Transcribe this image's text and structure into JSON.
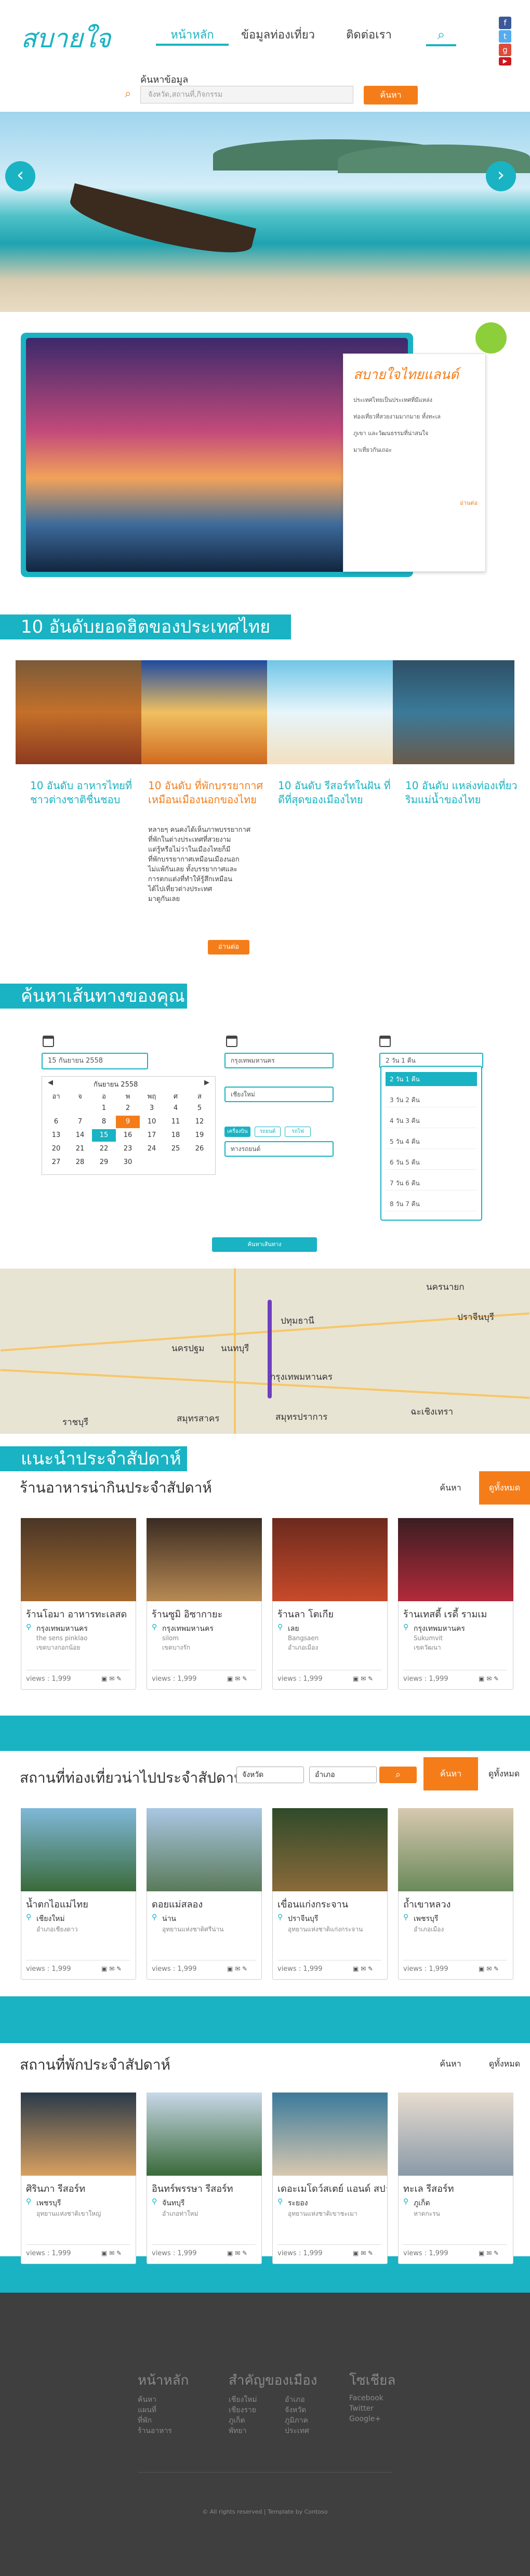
{
  "header": {
    "logo": "สบายใจ",
    "nav": [
      "หน้าหลัก",
      "ข้อมูลท่องเที่ยว",
      "ติดต่อเรา"
    ],
    "social_icons": [
      "facebook-icon",
      "twitter-icon",
      "googleplus-icon",
      "youtube-icon"
    ],
    "search": {
      "label": "ค้นหาข้อมูล",
      "placeholder": "จังหวัด,สถานที่,กิจกรรม",
      "button": "ค้นหา"
    }
  },
  "featured": {
    "title": "สบายใจไทยแลนด์",
    "lines": [
      "ประเทศไทยเป็นประเทศที่มีแหล่ง",
      "ท่องเที่ยวที่สวยงามมากมาย ทั้งทะเล",
      "ภูเขา และวัฒนธรรมที่น่าสนใจ",
      "มาเที่ยวกันเถอะ"
    ],
    "more": "อ่านต่อ"
  },
  "top10": {
    "title": "10 อันดับยอดฮิตของประเทศไทย",
    "items": [
      "10 อันดับ อาหารไทยที่ ชาวต่างชาติชื่นชอบ",
      "10 อันดับ ที่พักบรรยากาศ เหมือนเมืองนอกของไทย",
      "10 อันดับ รีสอร์ทในฝัน ที่ดีที่สุดของเมืองไทย",
      "10 อันดับ แหล่งท่องเที่ยว ริมแม่น้ำของไทย"
    ],
    "description": [
      "หลายๆ คนคงได้เห็นภาพบรรยากาศ",
      "ที่พักในต่างประเทศที่สวยงาม",
      "แต่รู้หรือไม่ว่าในเมืองไทยก็มี",
      "ที่พักบรรยากาศเหมือนเมืองนอก",
      "ไม่แพ้กันเลย ทั้งบรรยากาศและ",
      "การตกแต่งที่ทำให้รู้สึกเหมือน",
      "ได้ไปเที่ยวต่างประเทศ",
      "มาดูกันเลย"
    ],
    "more_button": "อ่านต่อ"
  },
  "route": {
    "title": "ค้นหาเส้นทางของคุณ",
    "date_value": "15 กันยายน 2558",
    "calendar": {
      "month": "กันยายน 2558",
      "prev": "◀",
      "next": "▶",
      "dow": [
        "อา",
        "จ",
        "อ",
        "พ",
        "พฤ",
        "ศ",
        "ส"
      ],
      "weeks": [
        [
          "",
          "",
          "1",
          "2",
          "3",
          "4",
          "5"
        ],
        [
          "6",
          "7",
          "8",
          "9",
          "10",
          "11",
          "12"
        ],
        [
          "13",
          "14",
          "15",
          "16",
          "17",
          "18",
          "19"
        ],
        [
          "20",
          "21",
          "22",
          "23",
          "24",
          "25",
          "26"
        ],
        [
          "27",
          "28",
          "29",
          "30",
          "",
          "",
          ""
        ]
      ],
      "highlight_day": "9",
      "selected_day": "15"
    },
    "from": "กรุงเทพมหานคร",
    "to": "เชียงใหม่",
    "modes": [
      "เครื่องบิน",
      "รถยนต์",
      "รถไฟ"
    ],
    "transport": "ทางรถยนต์",
    "duration_value": "2 วัน 1 คืน",
    "durations": [
      "2 วัน 1 คืน",
      "3 วัน 2 คืน",
      "4 วัน 3 คืน",
      "5 วัน 4 คืน",
      "6 วัน 5 คืน",
      "7 วัน 6 คืน",
      "8 วัน 7 คืน"
    ],
    "button": "ค้นหาเส้นทาง"
  },
  "map": {
    "labels": [
      "ปทุมธานี",
      "นนทบุรี",
      "นครปฐม",
      "กรุงเทพมหานคร",
      "สมุทรสาคร",
      "สมุทรปราการ",
      "ฉะเชิงเทรา",
      "ปราจีนบุรี",
      "นครนายก",
      "ราชบุรี"
    ]
  },
  "weekly": {
    "title": "แนะนำประจำสัปดาห์",
    "restaurants": {
      "title": "ร้านอาหารน่ากินประจำสัปดาห์",
      "tabs": [
        "ค้นหา",
        "ดูทั้งหมด"
      ],
      "items": [
        {
          "name": "ร้านโอมา อาหารทะเลสด",
          "prov": "กรุงเทพมหานคร",
          "sub": "the sens pinklao",
          "sub2": "เขตบางกอกน้อย",
          "views": "views : 1,999"
        },
        {
          "name": "ร้านซูมิ อิซากายะ",
          "prov": "กรุงเทพมหานคร",
          "sub": "silom",
          "sub2": "เขตบางรัก",
          "views": "views : 1,999"
        },
        {
          "name": "ร้านลา โตเกีย",
          "prov": "เลย",
          "sub": "Bangsaen",
          "sub2": "อำเภอเมือง",
          "views": "views : 1,999"
        },
        {
          "name": "ร้านเทสตี้ เรดี้ รามเม",
          "prov": "กรุงเทพมหานคร",
          "sub": "Sukumvit",
          "sub2": "เขตวัฒนา",
          "views": "views : 1,999"
        }
      ]
    },
    "attractions": {
      "title": "สถานที่ท่องเที่ยวน่าไปประจำสัปดาห์",
      "filter_province": "จังหวัด",
      "filter_area": "อำเภอ",
      "tabs": [
        "ค้นหา",
        "ดูทั้งหมด"
      ],
      "items": [
        {
          "name": "น้ำตกไอแม่ไทย",
          "prov": "เชียงใหม่",
          "sub": "อำเภอเชียงดาว",
          "views": "views : 1,999"
        },
        {
          "name": "ดอยแม่สลอง",
          "prov": "น่าน",
          "sub": "อุทยานแห่งชาติศรีน่าน",
          "views": "views : 1,999"
        },
        {
          "name": "เขื่อนแก่งกระจาน",
          "prov": "ปราจีนบุรี",
          "sub": "อุทยานแห่งชาติแก่งกระจาน",
          "views": "views : 1,999"
        },
        {
          "name": "ถ้ำเขาหลวง",
          "prov": "เพชรบุรี",
          "sub": "อำเภอเมือง",
          "views": "views : 1,999"
        }
      ]
    },
    "hotels": {
      "title": "สถานที่พักประจำสัปดาห์",
      "tabs": [
        "ค้นหา",
        "ดูทั้งหมด"
      ],
      "items": [
        {
          "name": "ศิรินภา รีสอร์ท",
          "prov": "เพชรบุรี",
          "sub": "อุทยานแห่งชาติเขาใหญ่",
          "views": "views : 1,999"
        },
        {
          "name": "อินทร์พรรษา รีสอร์ท",
          "prov": "จันทบุรี",
          "sub": "อำเภอท่าใหม่",
          "views": "views : 1,999"
        },
        {
          "name": "เดอะเมโดว์สเตย์ แอนด์ สปา",
          "prov": "ระยอง",
          "sub": "อุทยานแห่งชาติเขาชะเมา",
          "views": "views : 1,999"
        },
        {
          "name": "ทะเล รีสอร์ท",
          "prov": "ภูเก็ต",
          "sub": "หาดกะรน",
          "views": "views : 1,999"
        }
      ]
    }
  },
  "footer": {
    "cols": [
      {
        "head": "หน้าหลัก",
        "links": [
          "ค้นหา",
          "แผนที่",
          "ที่พัก",
          "ร้านอาหาร"
        ]
      },
      {
        "head": "สำคัญของเมือง",
        "links": [
          "เชียงใหม่",
          "เชียงราย",
          "ภูเก็ต",
          "พัทยา"
        ],
        "links2": [
          "อำเภอ",
          "จังหวัด",
          "ภูมิภาค",
          "ประเทศ"
        ]
      },
      {
        "head": "โซเชียล",
        "links": [
          "Facebook",
          "Twitter",
          "Google+"
        ]
      }
    ],
    "copyright": "© All rights reserved | Template by Contoso"
  },
  "colors": {
    "teal": "#19b3c3",
    "orange": "#f57d19",
    "footer": "#3f3f3f"
  }
}
